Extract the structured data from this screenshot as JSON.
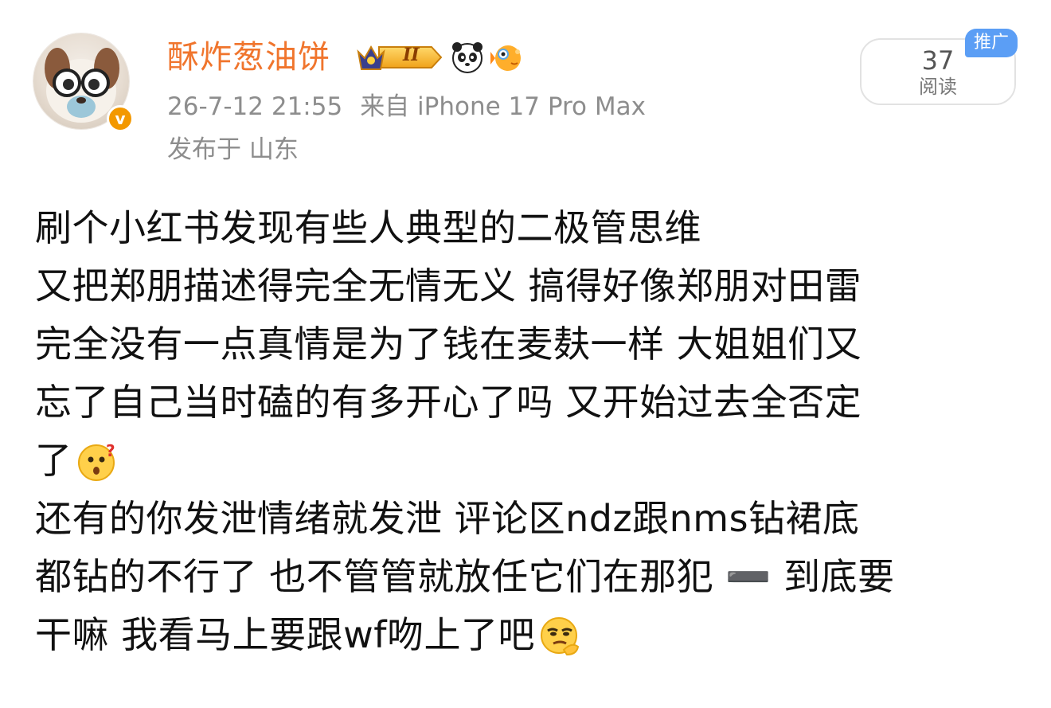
{
  "user": {
    "name": "酥炸葱油饼",
    "verified_icon": "v",
    "level_badge_text": "II"
  },
  "post_meta": {
    "timestamp": "26-7-12 21:55",
    "source": "来自 iPhone 17 Pro Max",
    "location": "发布于 山东"
  },
  "stats": {
    "read_count": "37",
    "read_label": "阅读",
    "promo_label": "推广"
  },
  "post": {
    "lines": [
      "刷个小红书发现有些人典型的二极管思维",
      "又把郑朋描述得完全无情无义 搞得好像郑朋对田雷",
      "完全没有一点真情是为了钱在麦麸一样 大姐姐们又",
      "忘了自己当时磕的有多开心了吗 又开始过去全否定",
      "了",
      "还有的你发泄情绪就发泄 评论区ndz跟nms钻裙底",
      "都钻的不行了 也不管管就放任它们在那犯 ➖ 到底要",
      "干嘛 我看马上要跟wf吻上了吧"
    ]
  },
  "icons": {
    "avatar": "dog-with-glasses-avatar",
    "verified": "verified-badge-icon",
    "level": "crown-level-badge-icon",
    "panda": "panda-emoji-icon",
    "fish": "puffer-fish-emoji-icon",
    "confused": "confused-face-emoji-icon",
    "smirk": "thinking-smirk-emoji-icon"
  },
  "colors": {
    "username": "#f0752d",
    "meta": "#8d8d8d",
    "promo": "#5b9ef5",
    "verified": "#f39800"
  }
}
